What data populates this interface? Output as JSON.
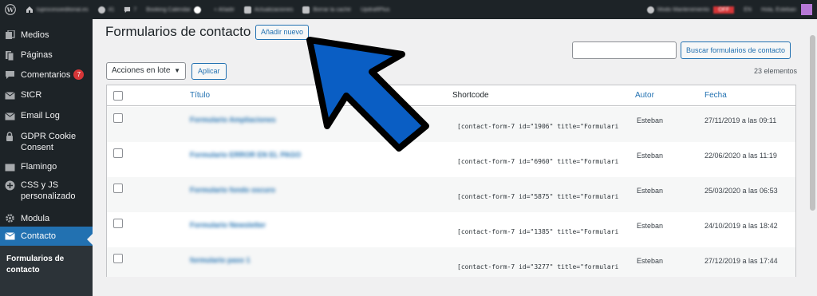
{
  "adminbar": {
    "site_name": "tuprocesoeditorial.es",
    "comments_count": "41",
    "pending_count": "7",
    "new_label": "+ Añadir",
    "items": [
      "Booking Calendar",
      "Actualizaciones",
      "Borrar la caché",
      "UpdraftPlus"
    ],
    "maintenance_label": "Modo Mantenimiento",
    "maintenance_badge": "OFF",
    "lang": "EN",
    "greeting": "Hola, Esteban",
    "icons": [
      "wordpress-logo-icon",
      "home-icon",
      "comment-icon",
      "plus-icon"
    ]
  },
  "sidebar": {
    "items": [
      {
        "label": "Medios",
        "icon": "media-icon"
      },
      {
        "label": "Páginas",
        "icon": "pages-icon"
      },
      {
        "label": "Comentarios",
        "icon": "comments-icon",
        "badge": "7"
      },
      {
        "label": "StCR",
        "icon": "mail-icon"
      },
      {
        "label": "Email Log",
        "icon": "mail-icon"
      },
      {
        "label": "GDPR Cookie Consent",
        "icon": "shield-icon"
      },
      {
        "label": "Flamingo",
        "icon": "mail-icon"
      },
      {
        "label": "CSS y JS personalizado",
        "icon": "plus-icon"
      },
      {
        "label": "Modula",
        "icon": "gear-icon"
      },
      {
        "label": "Contacto",
        "icon": "mail-icon",
        "current": true
      }
    ],
    "submenu_current": "Formularios de contacto"
  },
  "main": {
    "title": "Formularios de contacto",
    "add_new": "Añadir nuevo",
    "search_button": "Buscar formularios de contacto",
    "search_value": "",
    "bulk_action": "Acciones en lote",
    "apply": "Aplicar",
    "count": "23 elementos"
  },
  "table": {
    "headers": {
      "title": "Título",
      "shortcode": "Shortcode",
      "author": "Autor",
      "date": "Fecha"
    },
    "rows": [
      {
        "title": "Formulario Ampliaciones",
        "shortcode": "[contact-form-7 id=\"1906\" title=\"Formulari",
        "author": "Esteban",
        "date": "27/11/2019 a las 09:11"
      },
      {
        "title": "Formulario ERROR EN EL PAGO",
        "shortcode": "[contact-form-7 id=\"6960\" title=\"Formulari",
        "author": "Esteban",
        "date": "22/06/2020 a las 11:19"
      },
      {
        "title": "Formulario fondo oscuro",
        "shortcode": "[contact-form-7 id=\"5875\" title=\"Formulari",
        "author": "Esteban",
        "date": "25/03/2020 a las 06:53"
      },
      {
        "title": "Formulario Newsletter",
        "shortcode": "[contact-form-7 id=\"1385\" title=\"Formulari",
        "author": "Esteban",
        "date": "24/10/2019 a las 18:42"
      },
      {
        "title": "formulario paso 1",
        "shortcode": "[contact-form-7 id=\"3277\" title=\"formulari",
        "author": "Esteban",
        "date": "27/12/2019 a las 17:44"
      }
    ]
  },
  "colors": {
    "admin_dark": "#1d2327",
    "accent": "#2271b1",
    "badge_red": "#d63638",
    "arrow_blue": "#0a5ec4"
  }
}
